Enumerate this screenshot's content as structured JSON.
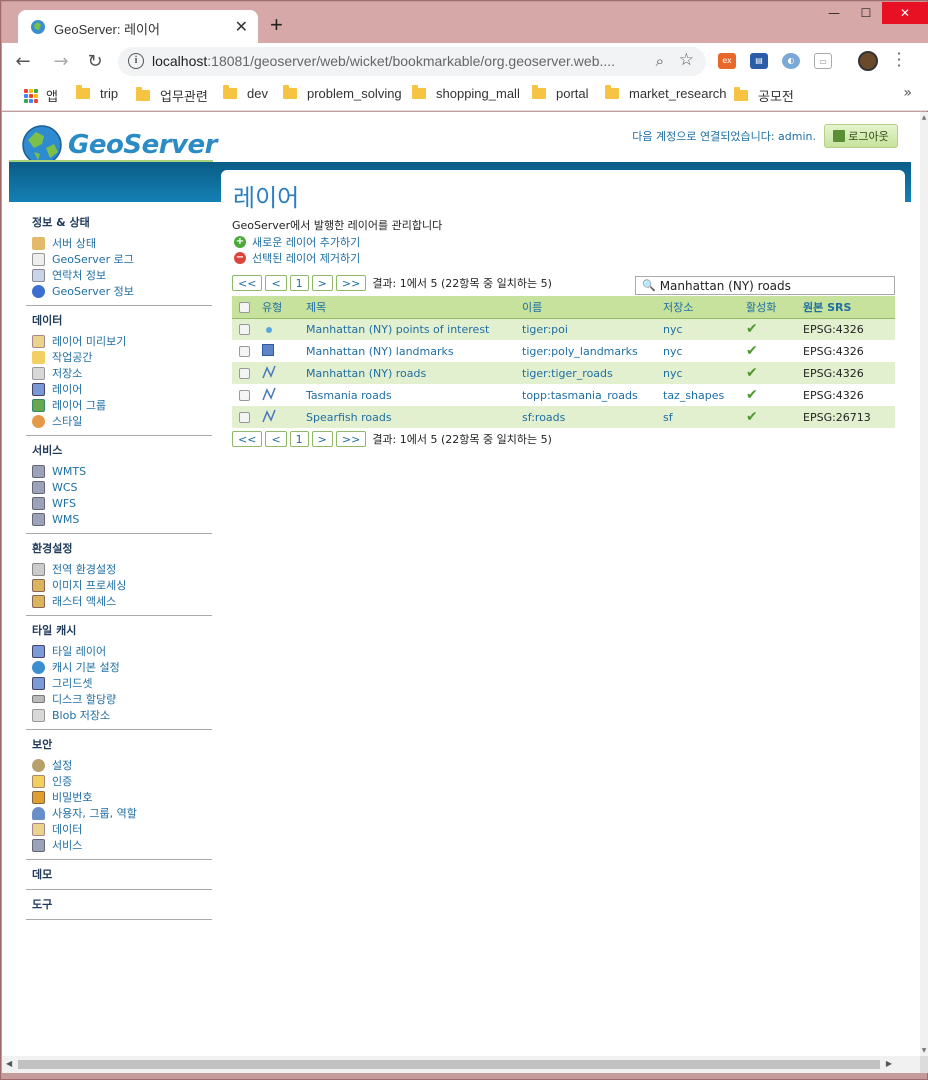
{
  "browser": {
    "tab_title": "GeoServer: 레이어",
    "new_tab": "+",
    "close_tab": "✕",
    "url_host": "localhost",
    "url_rest": ":18081/geoserver/web/wicket/bookmarkable/org.geoserver.web....",
    "win_min": "—",
    "win_max": "☐",
    "win_close": "✕"
  },
  "bookmarks": {
    "apps_label": "앱",
    "items": [
      "trip",
      "업무관련",
      "dev",
      "problem_solving",
      "shopping_mall",
      "portal",
      "market_research",
      "공모전"
    ],
    "more": "»"
  },
  "header": {
    "logo_text": "GeoServer",
    "login_text": "다음 계정으로 연결되었습니다: admin.",
    "logout_label": "로그아웃"
  },
  "sidebar": {
    "sections": [
      {
        "title": "정보 & 상태",
        "items": [
          "서버 상태",
          "GeoServer 로그",
          "연락처 정보",
          "GeoServer 정보"
        ]
      },
      {
        "title": "데이터",
        "items": [
          "레이어 미리보기",
          "작업공간",
          "저장소",
          "레이어",
          "레이어 그룹",
          "스타일"
        ]
      },
      {
        "title": "서비스",
        "items": [
          "WMTS",
          "WCS",
          "WFS",
          "WMS"
        ]
      },
      {
        "title": "환경설정",
        "items": [
          "전역 환경설정",
          "이미지 프로세싱",
          "래스터 액세스"
        ]
      },
      {
        "title": "타일 캐시",
        "items": [
          "타일 레이어",
          "캐시 기본 설정",
          "그리드셋",
          "디스크 할당량",
          "Blob 저장소"
        ]
      },
      {
        "title": "보안",
        "items": [
          "설정",
          "인증",
          "비밀번호",
          "사용자, 그룹, 역할",
          "데이터",
          "서비스"
        ]
      },
      {
        "title": "데모",
        "items": []
      },
      {
        "title": "도구",
        "items": []
      }
    ]
  },
  "main": {
    "title": "레이어",
    "description": "GeoServer에서 발행한 레이어를 관리합니다",
    "add_label": "새로운 레이어 추가하기",
    "remove_label": "선택된 레이어 제거하기",
    "pager": {
      "first": "<<",
      "prev": "<",
      "page": "1",
      "next": ">",
      "last": ">>",
      "info": "결과: 1에서 5 (22항목 중 일치하는 5)"
    },
    "search_value": "Manhattan (NY) roads",
    "columns": {
      "type": "유형",
      "title": "제목",
      "name": "이름",
      "store": "저장소",
      "enabled": "활성화",
      "srs": "원본 SRS"
    },
    "rows": [
      {
        "type": "point",
        "title": "Manhattan (NY) points of interest",
        "name": "tiger:poi",
        "store": "nyc",
        "srs": "EPSG:4326"
      },
      {
        "type": "polygon",
        "title": "Manhattan (NY) landmarks",
        "name": "tiger:poly_landmarks",
        "store": "nyc",
        "srs": "EPSG:4326"
      },
      {
        "type": "line",
        "title": "Manhattan (NY) roads",
        "name": "tiger:tiger_roads",
        "store": "nyc",
        "srs": "EPSG:4326"
      },
      {
        "type": "line",
        "title": "Tasmania roads",
        "name": "topp:tasmania_roads",
        "store": "taz_shapes",
        "srs": "EPSG:4326"
      },
      {
        "type": "line",
        "title": "Spearfish roads",
        "name": "sf:roads",
        "store": "sf",
        "srs": "EPSG:26713"
      }
    ]
  },
  "colors": {
    "accent": "#2a7fc0",
    "header_green": "#c6e29c",
    "row_alt": "#e2f0d0",
    "bluebar": "#0a5c86"
  }
}
